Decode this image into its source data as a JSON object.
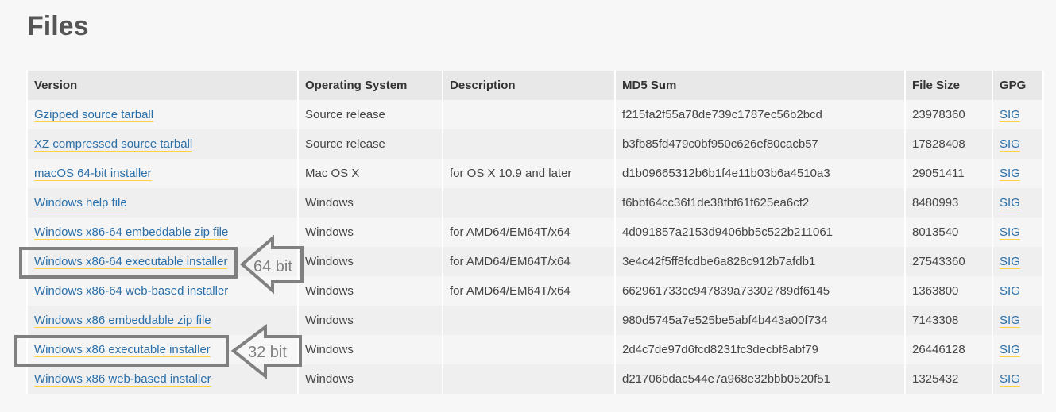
{
  "title": "Files",
  "headers": [
    "Version",
    "Operating System",
    "Description",
    "MD5 Sum",
    "File Size",
    "GPG"
  ],
  "rows": [
    {
      "version": "Gzipped source tarball",
      "os": "Source release",
      "desc": "",
      "md5": "f215fa2f55a78de739c1787ec56b2bcd",
      "size": "23978360",
      "gpg": "SIG"
    },
    {
      "version": "XZ compressed source tarball",
      "os": "Source release",
      "desc": "",
      "md5": "b3fb85fd479c0bf950c626ef80cacb57",
      "size": "17828408",
      "gpg": "SIG"
    },
    {
      "version": "macOS 64-bit installer",
      "os": "Mac OS X",
      "desc": "for OS X 10.9 and later",
      "md5": "d1b09665312b6b1f4e11b03b6a4510a3",
      "size": "29051411",
      "gpg": "SIG"
    },
    {
      "version": "Windows help file",
      "os": "Windows",
      "desc": "",
      "md5": "f6bbf64cc36f1de38fbf61f625ea6cf2",
      "size": "8480993",
      "gpg": "SIG"
    },
    {
      "version": "Windows x86-64 embeddable zip file",
      "os": "Windows",
      "desc": "for AMD64/EM64T/x64",
      "md5": "4d091857a2153d9406bb5c522b211061",
      "size": "8013540",
      "gpg": "SIG"
    },
    {
      "version": "Windows x86-64 executable installer",
      "os": "Windows",
      "desc": "for AMD64/EM64T/x64",
      "md5": "3e4c42f5ff8fcdbe6a828c912b7afdb1",
      "size": "27543360",
      "gpg": "SIG"
    },
    {
      "version": "Windows x86-64 web-based installer",
      "os": "Windows",
      "desc": "for AMD64/EM64T/x64",
      "md5": "662961733cc947839a73302789df6145",
      "size": "1363800",
      "gpg": "SIG"
    },
    {
      "version": "Windows x86 embeddable zip file",
      "os": "Windows",
      "desc": "",
      "md5": "980d5745a7e525be5abf4b443a00f734",
      "size": "7143308",
      "gpg": "SIG"
    },
    {
      "version": "Windows x86 executable installer",
      "os": "Windows",
      "desc": "",
      "md5": "2d4c7de97d6fcd8231fc3decbf8abf79",
      "size": "26446128",
      "gpg": "SIG"
    },
    {
      "version": "Windows x86 web-based installer",
      "os": "Windows",
      "desc": "",
      "md5": "d21706bdac544e7a968e32bbb0520f51",
      "size": "1325432",
      "gpg": "SIG"
    }
  ],
  "annotations": {
    "label_64": "64 bit",
    "label_32": "32 bit",
    "color": "#808080"
  }
}
